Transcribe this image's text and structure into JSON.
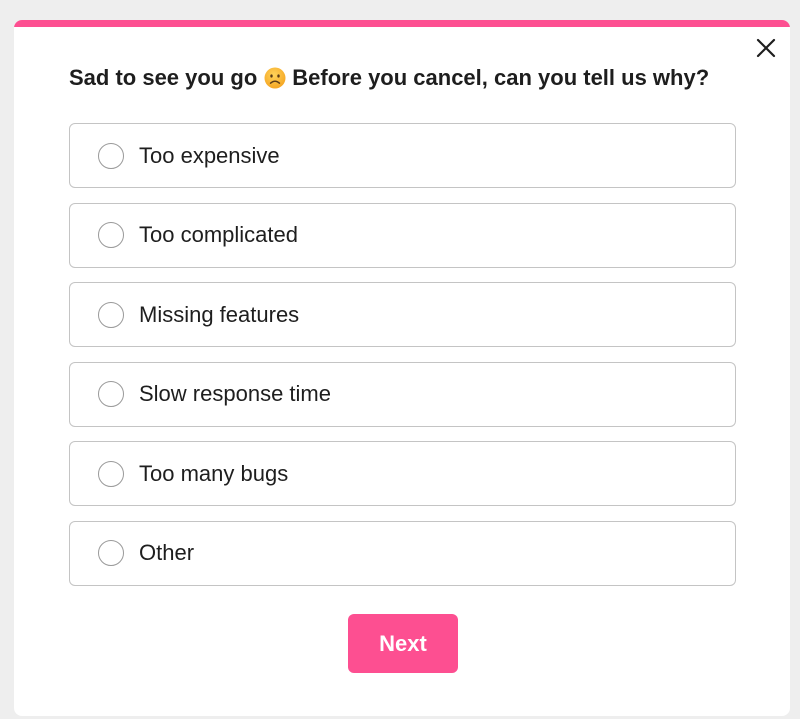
{
  "dialog": {
    "title_before_emoji": "Sad to see you go",
    "title_after_emoji": "Before you cancel, can you tell us why?",
    "emoji_icon": "frowning-face-icon",
    "close_icon": "close-icon",
    "accent_color": "#fd4f91"
  },
  "options": [
    {
      "label": "Too expensive",
      "selected": false
    },
    {
      "label": "Too complicated",
      "selected": false
    },
    {
      "label": "Missing features",
      "selected": false
    },
    {
      "label": "Slow response time",
      "selected": false
    },
    {
      "label": "Too many bugs",
      "selected": false
    },
    {
      "label": "Other",
      "selected": false
    }
  ],
  "actions": {
    "next_label": "Next"
  }
}
